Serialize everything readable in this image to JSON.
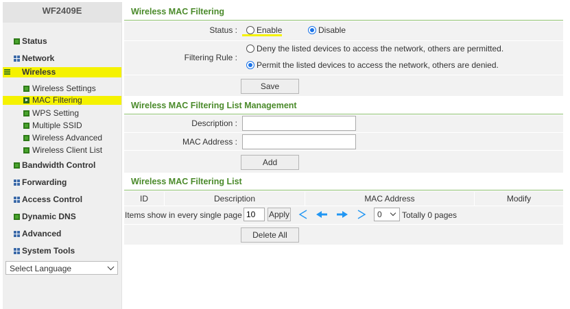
{
  "sidebar": {
    "model": "WF2409E",
    "items": [
      {
        "label": "Status",
        "icon": "green-square-icon"
      },
      {
        "label": "Network",
        "icon": "grid-icon"
      },
      {
        "label": "Wireless",
        "icon": "expanded-lines-icon"
      },
      {
        "label": "Bandwidth Control",
        "icon": "green-square-icon"
      },
      {
        "label": "Forwarding",
        "icon": "grid-icon"
      },
      {
        "label": "Access Control",
        "icon": "grid-icon"
      },
      {
        "label": "Dynamic DNS",
        "icon": "green-square-icon"
      },
      {
        "label": "Advanced",
        "icon": "grid-icon"
      },
      {
        "label": "System Tools",
        "icon": "grid-icon"
      }
    ],
    "wireless_sub": [
      {
        "label": "Wireless Settings"
      },
      {
        "label": "MAC Filtering"
      },
      {
        "label": "WPS Setting"
      },
      {
        "label": "Multiple SSID"
      },
      {
        "label": "Wireless Advanced"
      },
      {
        "label": "Wireless Client List"
      }
    ],
    "language": "Select Language"
  },
  "filtering": {
    "title": "Wireless MAC Filtering",
    "status_label": "Status :",
    "enable_label": "Enable",
    "disable_label": "Disable",
    "status_value": "Disable",
    "rule_label": "Filtering Rule :",
    "rule_deny": "Deny the listed devices to access the network, others are permitted.",
    "rule_permit": "Permit the listed devices to access the network, others are denied.",
    "rule_value": "permit",
    "save_label": "Save"
  },
  "management": {
    "title": "Wireless MAC Filtering List Management",
    "description_label": "Description :",
    "description_value": "",
    "mac_label": "MAC Address :",
    "mac_value": "",
    "add_label": "Add"
  },
  "list": {
    "title": "Wireless MAC Filtering List",
    "columns": [
      "ID",
      "Description",
      "MAC Address",
      "Modify"
    ],
    "items_label": "Items show in every single page",
    "items_per_page": "10",
    "apply_label": "Apply",
    "page_value": "0",
    "total_label": "Totally 0 pages",
    "delete_all_label": "Delete All"
  },
  "colors": {
    "accent_green": "#4a8a2a",
    "highlight": "#f5f200",
    "pager_blue": "#2196f3"
  }
}
